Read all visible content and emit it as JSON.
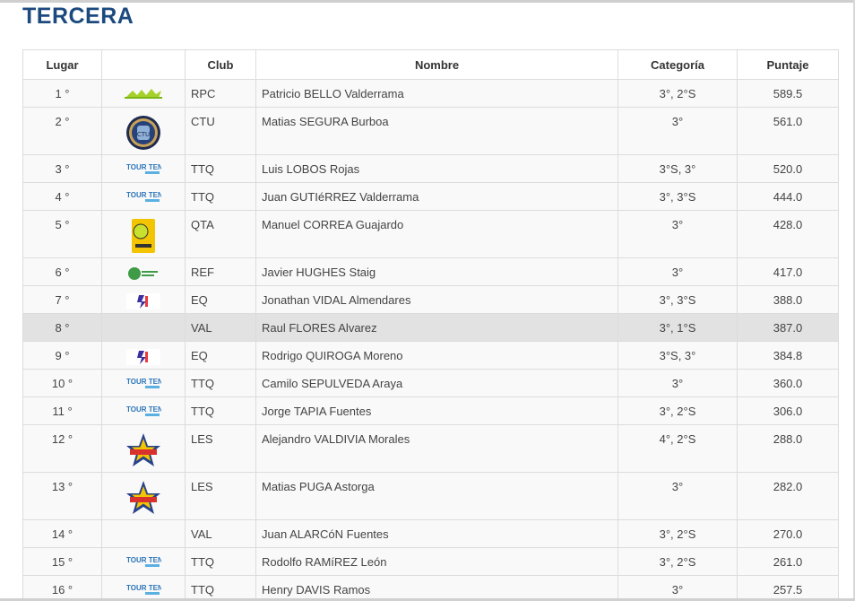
{
  "section_title": "TERCERA",
  "headers": {
    "lugar": "Lugar",
    "logo": "",
    "club": "Club",
    "nombre": "Nombre",
    "categoria": "Categoría",
    "puntaje": "Puntaje"
  },
  "rows": [
    {
      "lugar": "1 °",
      "logo": "rpc-logo",
      "club": "RPC",
      "nombre": "Patricio BELLO Valderrama",
      "categoria": "3°, 2°S",
      "puntaje": "589.5"
    },
    {
      "lugar": "2 °",
      "logo": "ctu-logo",
      "club": "CTU",
      "nombre": "Matias SEGURA Burboa",
      "categoria": "3°",
      "puntaje": "561.0"
    },
    {
      "lugar": "3 °",
      "logo": "ttq-logo",
      "club": "TTQ",
      "nombre": "Luis LOBOS Rojas",
      "categoria": "3°S, 3°",
      "puntaje": "520.0"
    },
    {
      "lugar": "4 °",
      "logo": "ttq-logo",
      "club": "TTQ",
      "nombre": "Juan GUTIéRREZ Valderrama",
      "categoria": "3°, 3°S",
      "puntaje": "444.0"
    },
    {
      "lugar": "5 °",
      "logo": "qta-logo",
      "club": "QTA",
      "nombre": "Manuel CORREA Guajardo",
      "categoria": "3°",
      "puntaje": "428.0"
    },
    {
      "lugar": "6 °",
      "logo": "ref-logo",
      "club": "REF",
      "nombre": "Javier HUGHES Staig",
      "categoria": "3°",
      "puntaje": "417.0"
    },
    {
      "lugar": "7 °",
      "logo": "eq-logo",
      "club": "EQ",
      "nombre": "Jonathan VIDAL Almendares",
      "categoria": "3°, 3°S",
      "puntaje": "388.0"
    },
    {
      "lugar": "8 °",
      "logo": "",
      "club": "VAL",
      "nombre": "Raul FLORES Alvarez",
      "categoria": "3°, 1°S",
      "puntaje": "387.0",
      "highlight": true
    },
    {
      "lugar": "9 °",
      "logo": "eq-logo",
      "club": "EQ",
      "nombre": "Rodrigo QUIROGA Moreno",
      "categoria": "3°S, 3°",
      "puntaje": "384.8"
    },
    {
      "lugar": "10 °",
      "logo": "ttq-logo",
      "club": "TTQ",
      "nombre": "Camilo SEPULVEDA Araya",
      "categoria": "3°",
      "puntaje": "360.0"
    },
    {
      "lugar": "11 °",
      "logo": "ttq-logo",
      "club": "TTQ",
      "nombre": "Jorge TAPIA Fuentes",
      "categoria": "3°, 2°S",
      "puntaje": "306.0"
    },
    {
      "lugar": "12 °",
      "logo": "les-logo",
      "club": "LES",
      "nombre": "Alejandro VALDIVIA Morales",
      "categoria": "4°, 2°S",
      "puntaje": "288.0"
    },
    {
      "lugar": "13 °",
      "logo": "les-logo",
      "club": "LES",
      "nombre": "Matias PUGA Astorga",
      "categoria": "3°",
      "puntaje": "282.0"
    },
    {
      "lugar": "14 °",
      "logo": "",
      "club": "VAL",
      "nombre": "Juan ALARCóN Fuentes",
      "categoria": "3°, 2°S",
      "puntaje": "270.0"
    },
    {
      "lugar": "15 °",
      "logo": "ttq-logo",
      "club": "TTQ",
      "nombre": "Rodolfo RAMíREZ León",
      "categoria": "3°, 2°S",
      "puntaje": "261.0"
    },
    {
      "lugar": "16 °",
      "logo": "ttq-logo",
      "club": "TTQ",
      "nombre": "Henry DAVIS Ramos",
      "categoria": "3°",
      "puntaje": "257.5"
    }
  ]
}
